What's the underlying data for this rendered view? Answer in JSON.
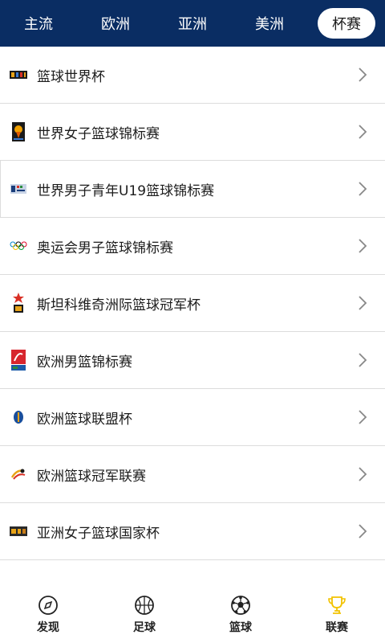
{
  "tabs": [
    {
      "label": "主流",
      "active": false
    },
    {
      "label": "欧洲",
      "active": false
    },
    {
      "label": "亚洲",
      "active": false
    },
    {
      "label": "美洲",
      "active": false
    },
    {
      "label": "杯赛",
      "active": true
    }
  ],
  "competitions": [
    {
      "label": "篮球世界杯",
      "icon": "fiba-world-cup-logo-icon"
    },
    {
      "label": "世界女子篮球锦标赛",
      "icon": "fiba-women-world-cup-logo-icon"
    },
    {
      "label": "世界男子青年U19篮球锦标赛",
      "icon": "fiba-u19-logo-icon"
    },
    {
      "label": "奥运会男子篮球锦标赛",
      "icon": "olympic-rings-icon"
    },
    {
      "label": "斯坦科维奇洲际篮球冠军杯",
      "icon": "stankovic-cup-logo-icon"
    },
    {
      "label": "欧洲男篮锦标赛",
      "icon": "eurobasket-logo-icon"
    },
    {
      "label": "欧洲篮球联盟杯",
      "icon": "euroleague-cup-logo-icon"
    },
    {
      "label": "欧洲篮球冠军联赛",
      "icon": "champions-league-logo-icon"
    },
    {
      "label": "亚洲女子篮球国家杯",
      "icon": "fiba-asia-women-logo-icon"
    }
  ],
  "nav": [
    {
      "label": "发现",
      "icon": "compass-icon"
    },
    {
      "label": "足球",
      "icon": "basketball-icon"
    },
    {
      "label": "篮球",
      "icon": "soccer-ball-icon"
    },
    {
      "label": "联赛",
      "icon": "trophy-icon"
    }
  ],
  "colors": {
    "header_bg": "#0a2d63",
    "trophy": "#f2c200"
  }
}
